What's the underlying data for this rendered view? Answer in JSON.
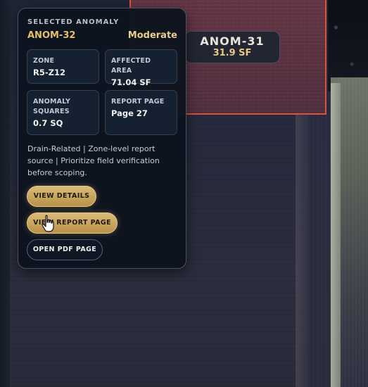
{
  "map": {
    "anom31": {
      "id": "ANOM-31",
      "area": "31.9 SF"
    }
  },
  "card": {
    "heading": "SELECTED ANOMALY",
    "anomaly_id": "ANOM-32",
    "severity": "Moderate",
    "tiles": [
      {
        "label": "ZONE",
        "value": "R5-Z12"
      },
      {
        "label": "AFFECTED AREA",
        "value": "71.04 SF"
      },
      {
        "label": "ANOMALY SQUARES",
        "value": "0.7 SQ"
      },
      {
        "label": "REPORT PAGE",
        "value": "Page 27"
      }
    ],
    "description": "Drain-Related | Zone-level report source | Prioritize field verification before scoping.",
    "buttons": {
      "view_details": "VIEW DETAILS",
      "view_report_page": "VIEW REPORT PAGE",
      "open_pdf_page": "OPEN PDF PAGE"
    }
  },
  "colors": {
    "accent_gold": "#e6bf6c",
    "anomaly_outline": "#d9533a",
    "card_bg": "#0e141e"
  },
  "icons": {
    "cursor": "hand-pointer-icon"
  }
}
